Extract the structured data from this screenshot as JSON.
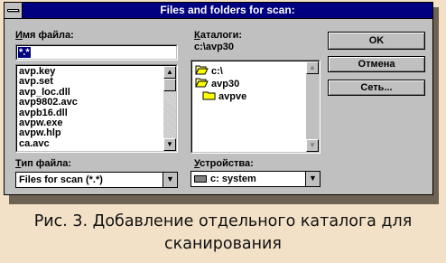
{
  "dialog": {
    "title": "Files and folders for scan:",
    "filename_label_u": "И",
    "filename_label_rest": "мя файла:",
    "filename_value": "*.*",
    "files": [
      "avp.key",
      "avp.set",
      "avp_loc.dll",
      "avp9802.avc",
      "avpb16.dll",
      "avpw.exe",
      "avpw.hlp",
      "ca.avc"
    ],
    "filetype_label_u": "Т",
    "filetype_label_rest": "ип файла:",
    "filetype_value": "Files for scan (*.*)",
    "dirs_label_u": "К",
    "dirs_label_rest": "аталоги:",
    "current_path": "c:\\avp30",
    "dirs": [
      "c:\\",
      "avp30",
      "avpve"
    ],
    "drives_label_u": "У",
    "drives_label_rest": "стройства:",
    "drive_value": "c: system",
    "buttons": {
      "ok": "OK",
      "cancel": "Отмена",
      "network": "Сеть..."
    }
  },
  "caption_line1": "Рис. 3. Добавление отдельного каталога для",
  "caption_line2": "сканирования"
}
